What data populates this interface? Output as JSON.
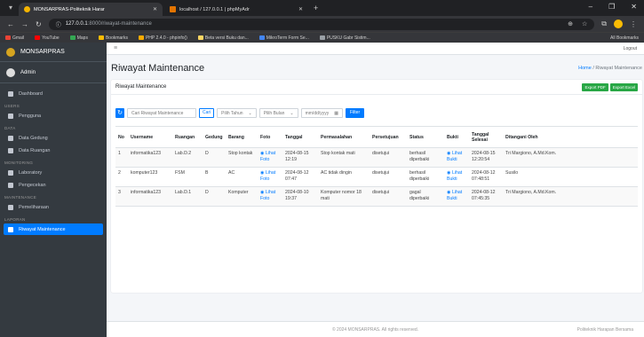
{
  "browser": {
    "tabs": [
      {
        "title": "MONSARPRAS-Politeknik Harar",
        "active": true
      },
      {
        "title": "localhost / 127.0.0.1 | phpMyAdr",
        "active": false
      }
    ],
    "url_host": "127.0.0.1",
    "url_path": ":8000/riwayat-maintenance",
    "bookmarks": [
      "Gmail",
      "YouTube",
      "Maps",
      "Bookmarks",
      "PHP 2.4.0 - phpinfo()",
      "Beta versi Buku dan...",
      "MikroTerm Form Se...",
      "PUSKU Gabr Sistim..."
    ],
    "all_bookmarks": "All Bookmarks"
  },
  "sidebar": {
    "brand": "MONSARPRAS",
    "user": "Admin",
    "dashboard": "Dashboard",
    "sections": [
      {
        "header": "USERS",
        "items": [
          "Pengguna"
        ]
      },
      {
        "header": "DATA",
        "items": [
          "Data Gedung",
          "Data Ruangan"
        ]
      },
      {
        "header": "MONITORING",
        "items": [
          "Laboratory",
          "Pengecekan"
        ]
      },
      {
        "header": "MAINTENANCE",
        "items": [
          "Pemeliharaan"
        ]
      },
      {
        "header": "LAPORAN",
        "items": [
          "Riwayat Maintenance"
        ]
      }
    ]
  },
  "topbar": {
    "logout": "Logout"
  },
  "page": {
    "title": "Riwayat Maintenance",
    "crumb_home": "Home",
    "crumb_sep": " / ",
    "crumb_current": "Riwayat Maintenance",
    "card_title": "Riwayat Maintenance",
    "export_pdf": "Export PDF",
    "export_excel": "Export Excel"
  },
  "filters": {
    "search_placeholder": "Cari Riwayat Maintenance",
    "search_btn": "Cari",
    "year": "Pilih Tahun",
    "month": "Pilih Bulan",
    "date_placeholder": "mm/dd/yyyy",
    "filter_btn": "Filter"
  },
  "table": {
    "headers": [
      "No",
      "Username",
      "Ruangan",
      "Gedung",
      "Barang",
      "Foto",
      "Tanggal",
      "Permasalahan",
      "Persetujuan",
      "Status",
      "Bukti",
      "Tanggal Selesai",
      "Ditangani Oleh"
    ],
    "rows": [
      [
        "1",
        "informatika123",
        "Lab.D.2",
        "D",
        "Stop kontak",
        "Lihat Foto",
        "2024-08-15 12:19",
        "Stop kontak mati",
        "disetujui",
        "berhasil diperbaiki",
        "Lihat Bukti",
        "2024-08-15 12:20:54",
        "Tri Margiono, A.Md.Kom."
      ],
      [
        "2",
        "komputer123",
        "FSM",
        "B",
        "AC",
        "Lihat Foto",
        "2024-08-12 07:47",
        "AC tidak dingin",
        "disetujui",
        "berhasil diperbaiki",
        "Lihat Bukti",
        "2024-08-12 07:48:51",
        "Susilo"
      ],
      [
        "3",
        "informatika123",
        "Lab.D.1",
        "D",
        "Komputer",
        "Lihat Foto",
        "2024-08-10 19:37",
        "Komputer nomor 18 mati",
        "disetujui",
        "gagal diperbaiki",
        "Lihat Bukti",
        "2024-08-12 07:45:35",
        "Tri Margiono, A.Md.Kom."
      ]
    ]
  },
  "footer": {
    "copyright": "© 2024 MONSARPRAS. All rights reserved.",
    "right": "Politeknik Harapan Bersama"
  }
}
